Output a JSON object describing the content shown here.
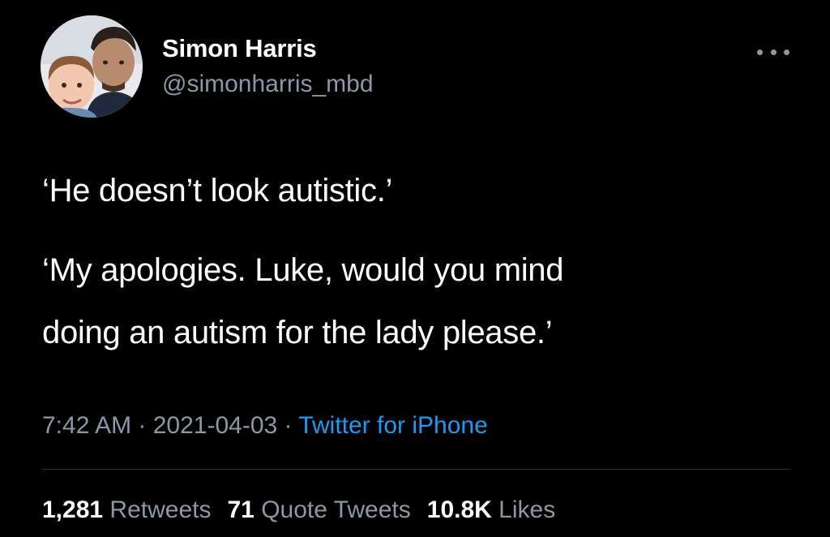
{
  "author": {
    "name": "Simon Harris",
    "handle": "@simonharris_mbd",
    "avatar_icon": "profile-photo-father-and-son"
  },
  "more_icon": "more-horizontal-icon",
  "tweet": {
    "lines": [
      "‘He doesn’t look autistic.’",
      "‘My apologies. Luke, would you mind",
      "doing an autism for the lady please.’"
    ]
  },
  "meta": {
    "time": "7:42 AM",
    "separator": " · ",
    "date": "2021-04-03",
    "source": "Twitter for iPhone"
  },
  "stats": {
    "retweets_count": "1,281",
    "retweets_label": "Retweets",
    "quotes_count": "71",
    "quotes_label": "Quote Tweets",
    "likes_count": "10.8K",
    "likes_label": "Likes"
  },
  "colors": {
    "background": "#000000",
    "text_primary": "#ffffff",
    "text_secondary": "#8b98a5",
    "link": "#1d9bf0",
    "divider": "#2f3336"
  }
}
